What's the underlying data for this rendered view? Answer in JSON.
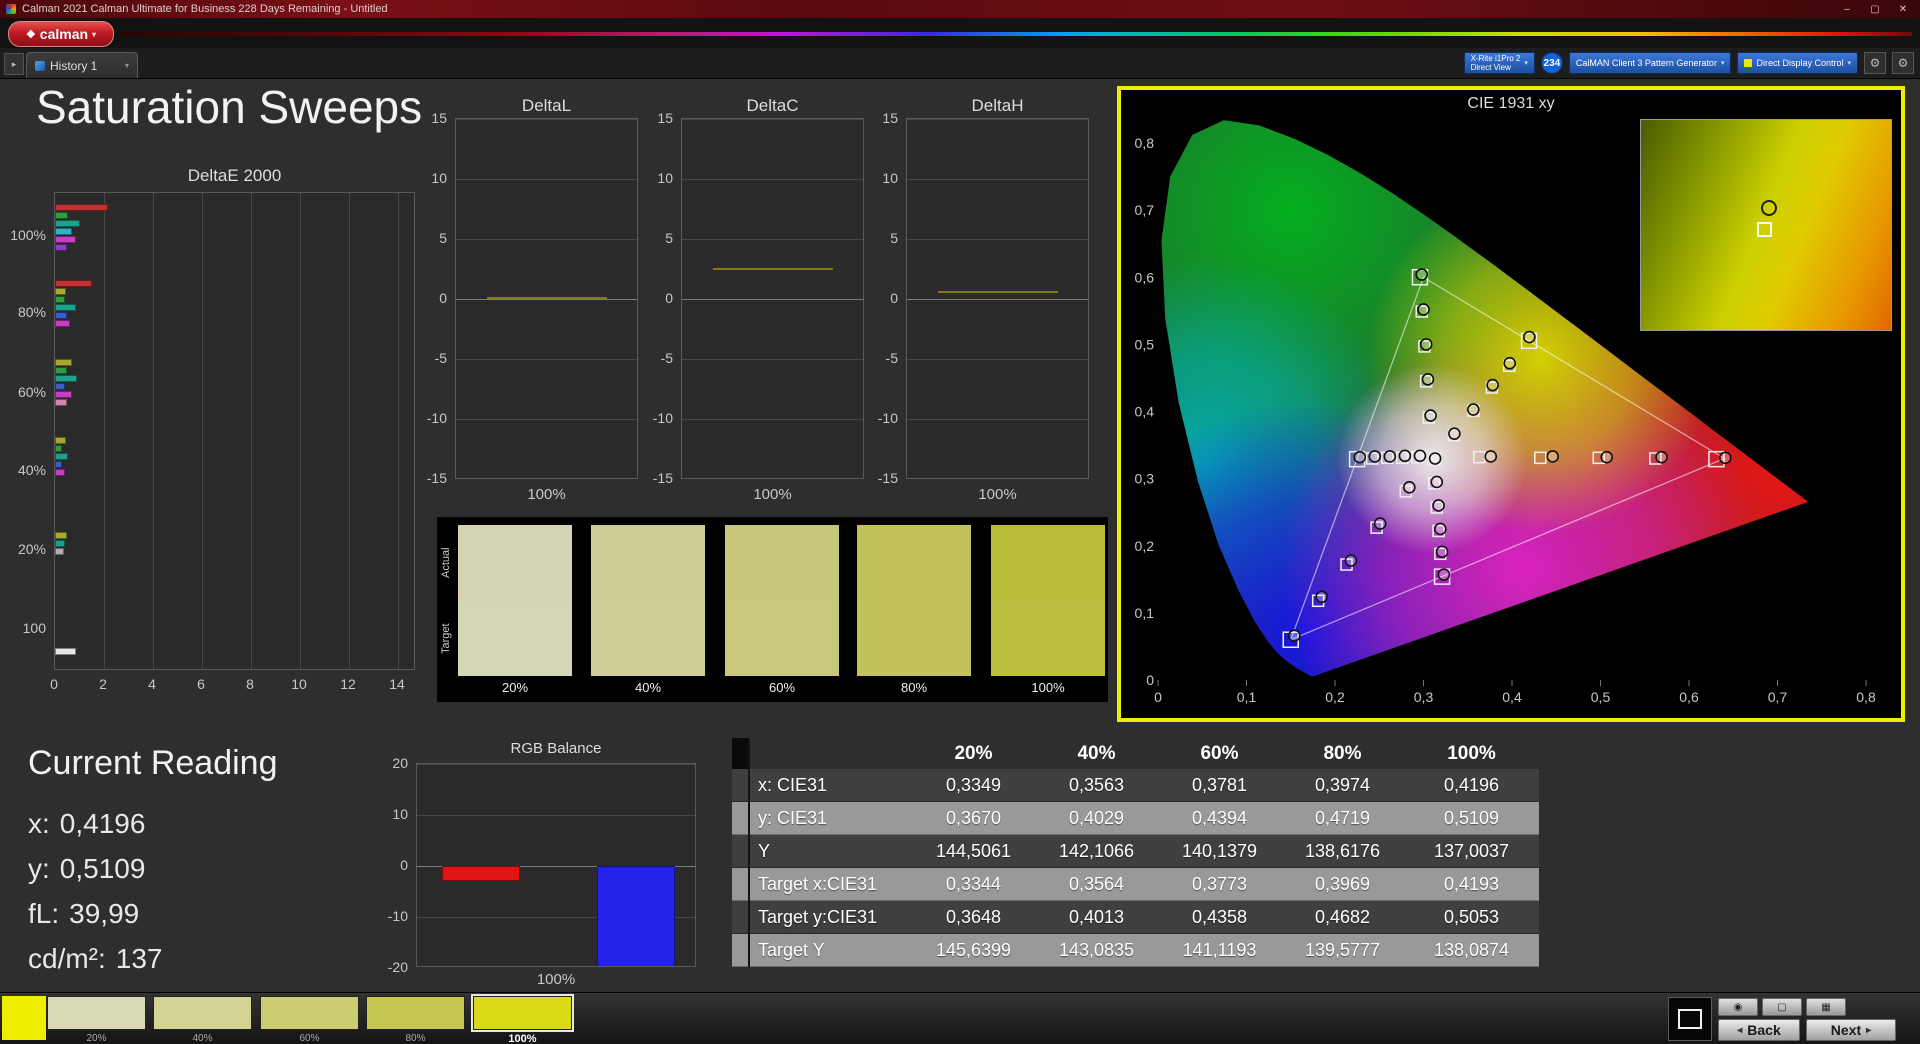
{
  "window": {
    "title": "Calman 2021 Calman Ultimate for Business 228 Days Remaining  - Untitled"
  },
  "icons": {
    "app_diamond": "❖",
    "dropdown_arrow": "▾",
    "minimize": "–",
    "maximize": "▢",
    "close": "✕",
    "expander": "▸",
    "gear": "⚙",
    "back_chevron": "◂",
    "next_chevron": "▸",
    "camera": "◉",
    "display": "▢",
    "printer": "▦"
  },
  "brand": {
    "name": "calman"
  },
  "nav": {
    "history_tab": "History 1"
  },
  "toolbar": {
    "meter_line1": "X-Rite i1Pro 2",
    "meter_line2": "Direct View",
    "meter_badge": "234",
    "generator": "CalMAN Client 3 Pattern Generator",
    "display_control": "Direct Display Control"
  },
  "page_title": "Saturation Sweeps",
  "current_reading": {
    "title": "Current Reading",
    "lines": [
      {
        "label": "x:",
        "value": "0,4196"
      },
      {
        "label": "y:",
        "value": "0,5109"
      },
      {
        "label": "fL:",
        "value": "39,99"
      },
      {
        "label": "cd/m²:",
        "value": "137"
      }
    ]
  },
  "bottom": {
    "back_label": "Back",
    "next_label": "Next",
    "swatches": [
      {
        "label": "20%",
        "color": "#dadab6",
        "selected": false
      },
      {
        "label": "40%",
        "color": "#d3d394",
        "selected": false
      },
      {
        "label": "60%",
        "color": "#cccc72",
        "selected": false
      },
      {
        "label": "80%",
        "color": "#c6c650",
        "selected": false
      },
      {
        "label": "100%",
        "color": "#d9d916",
        "selected": true
      }
    ]
  },
  "chart_data": {
    "deltae": {
      "type": "bar",
      "title": "DeltaE 2000",
      "x_ticks": [
        0,
        2,
        4,
        6,
        8,
        10,
        12,
        14
      ],
      "y_labels": [
        {
          "text": "100%",
          "offset": 44
        },
        {
          "text": "80%",
          "offset": 121
        },
        {
          "text": "60%",
          "offset": 201
        },
        {
          "text": "40%",
          "offset": 279
        },
        {
          "text": "20%",
          "offset": 358
        },
        {
          "text": "100",
          "offset": 437
        }
      ],
      "bars": [
        {
          "offset": 11,
          "color": "#c03232",
          "value": 2.15
        },
        {
          "offset": 19,
          "color": "#2d9e42",
          "value": 0.55
        },
        {
          "offset": 27,
          "color": "#1fa08c",
          "value": 1.0
        },
        {
          "offset": 35,
          "color": "#2fb3c4",
          "value": 0.7
        },
        {
          "offset": 43,
          "color": "#c43fc4",
          "value": 0.85
        },
        {
          "offset": 51,
          "color": "#8a3fc4",
          "value": 0.5
        },
        {
          "offset": 87,
          "color": "#c03232",
          "value": 1.5
        },
        {
          "offset": 95,
          "color": "#a8a832",
          "value": 0.45
        },
        {
          "offset": 103,
          "color": "#2d9e42",
          "value": 0.4
        },
        {
          "offset": 111,
          "color": "#1fa08c",
          "value": 0.85
        },
        {
          "offset": 119,
          "color": "#3c5cc8",
          "value": 0.5
        },
        {
          "offset": 127,
          "color": "#c43fc4",
          "value": 0.6
        },
        {
          "offset": 166,
          "color": "#a8a832",
          "value": 0.7
        },
        {
          "offset": 174,
          "color": "#2d9e42",
          "value": 0.5
        },
        {
          "offset": 182,
          "color": "#1fa08c",
          "value": 0.9
        },
        {
          "offset": 190,
          "color": "#3c5cc8",
          "value": 0.4
        },
        {
          "offset": 198,
          "color": "#c43fc4",
          "value": 0.7
        },
        {
          "offset": 206,
          "color": "#d585a8",
          "value": 0.5
        },
        {
          "offset": 244,
          "color": "#a8a832",
          "value": 0.45
        },
        {
          "offset": 252,
          "color": "#2d9e42",
          "value": 0.3
        },
        {
          "offset": 260,
          "color": "#1fa08c",
          "value": 0.55
        },
        {
          "offset": 268,
          "color": "#3c5cc8",
          "value": 0.3
        },
        {
          "offset": 276,
          "color": "#c43fc4",
          "value": 0.4
        },
        {
          "offset": 339,
          "color": "#a8a832",
          "value": 0.5
        },
        {
          "offset": 347,
          "color": "#1fa08c",
          "value": 0.4
        },
        {
          "offset": 355,
          "color": "#b0b0b0",
          "value": 0.35
        },
        {
          "offset": 455,
          "color": "#e8e8e8",
          "value": 0.85
        }
      ]
    },
    "delta_charts": [
      {
        "type": "bar",
        "title": "DeltaL",
        "y_ticks": [
          15,
          10,
          5,
          0,
          -5,
          -10,
          -15
        ],
        "x_label": "100%",
        "value": 0.15
      },
      {
        "type": "bar",
        "title": "DeltaC",
        "y_ticks": [
          15,
          10,
          5,
          0,
          -5,
          -10,
          -15
        ],
        "x_label": "100%",
        "value": 2.6
      },
      {
        "type": "bar",
        "title": "DeltaH",
        "y_ticks": [
          15,
          10,
          5,
          0,
          -5,
          -10,
          -15
        ],
        "x_label": "100%",
        "value": 0.7
      }
    ],
    "swatch_compare": {
      "row_labels": [
        "Actual",
        "Target"
      ],
      "items": [
        {
          "label": "20%",
          "actual": "#d4d4b5",
          "target": "#d5d5b7"
        },
        {
          "label": "40%",
          "actual": "#cdcd97",
          "target": "#cece99"
        },
        {
          "label": "60%",
          "actual": "#c7c779",
          "target": "#c8c87b"
        },
        {
          "label": "80%",
          "actual": "#c1c15b",
          "target": "#c2c25d"
        },
        {
          "label": "100%",
          "actual": "#bbbb3c",
          "target": "#bcbc3e"
        }
      ]
    },
    "cie": {
      "type": "scatter",
      "title": "CIE 1931 xy",
      "x_tick_labels": [
        "0",
        "0,1",
        "0,2",
        "0,3",
        "0,4",
        "0,5",
        "0,6",
        "0,7",
        "0,8"
      ],
      "y_tick_labels": [
        "0",
        "0,1",
        "0,2",
        "0,3",
        "0,4",
        "0,5",
        "0,6",
        "0,7",
        "0,8"
      ],
      "triangle": [
        [
          0.64,
          0.33
        ],
        [
          0.3,
          0.6
        ],
        [
          0.15,
          0.06
        ]
      ],
      "sweeps": [
        {
          "name": "yellow",
          "targets": [
            [
              0.3344,
              0.3648
            ],
            [
              0.3564,
              0.4013
            ],
            [
              0.3773,
              0.4358
            ],
            [
              0.3969,
              0.4682
            ],
            [
              0.4193,
              0.5053
            ]
          ],
          "measured": [
            [
              0.3349,
              0.367
            ],
            [
              0.3563,
              0.4029
            ],
            [
              0.3781,
              0.4394
            ],
            [
              0.3974,
              0.4719
            ],
            [
              0.4196,
              0.5109
            ]
          ]
        },
        {
          "name": "red",
          "targets": [
            [
              0.363,
              0.332
            ],
            [
              0.432,
              0.331
            ],
            [
              0.498,
              0.331
            ],
            [
              0.562,
              0.33
            ],
            [
              0.631,
              0.329
            ]
          ],
          "measured": [
            [
              0.376,
              0.333
            ],
            [
              0.446,
              0.333
            ],
            [
              0.507,
              0.332
            ],
            [
              0.569,
              0.332
            ],
            [
              0.641,
              0.331
            ]
          ]
        },
        {
          "name": "green",
          "targets": [
            [
              0.306,
              0.391
            ],
            [
              0.303,
              0.445
            ],
            [
              0.301,
              0.497
            ],
            [
              0.298,
              0.549
            ],
            [
              0.296,
              0.6
            ]
          ],
          "measured": [
            [
              0.308,
              0.394
            ],
            [
              0.305,
              0.448
            ],
            [
              0.303,
              0.5
            ],
            [
              0.3,
              0.552
            ],
            [
              0.298,
              0.604
            ]
          ]
        },
        {
          "name": "cyan",
          "targets": [
            [
              0.293,
              0.332
            ],
            [
              0.276,
              0.331
            ],
            [
              0.259,
              0.331
            ],
            [
              0.242,
              0.33
            ],
            [
              0.225,
              0.329
            ]
          ],
          "measured": [
            [
              0.296,
              0.334
            ],
            [
              0.279,
              0.334
            ],
            [
              0.262,
              0.333
            ],
            [
              0.245,
              0.333
            ],
            [
              0.228,
              0.332
            ]
          ]
        },
        {
          "name": "blue",
          "targets": [
            [
              0.28,
              0.281
            ],
            [
              0.247,
              0.227
            ],
            [
              0.213,
              0.172
            ],
            [
              0.181,
              0.118
            ],
            [
              0.15,
              0.06
            ]
          ],
          "measured": [
            [
              0.284,
              0.287
            ],
            [
              0.251,
              0.233
            ],
            [
              0.218,
              0.178
            ],
            [
              0.185,
              0.124
            ],
            [
              0.154,
              0.066
            ]
          ]
        },
        {
          "name": "magenta",
          "targets": [
            [
              0.312,
              0.293
            ],
            [
              0.315,
              0.257
            ],
            [
              0.317,
              0.222
            ],
            [
              0.319,
              0.188
            ],
            [
              0.321,
              0.154
            ]
          ],
          "measured": [
            [
              0.315,
              0.295
            ],
            [
              0.317,
              0.26
            ],
            [
              0.319,
              0.225
            ],
            [
              0.321,
              0.191
            ],
            [
              0.323,
              0.157
            ]
          ]
        },
        {
          "name": "white",
          "targets": [
            [
              0.3127,
              0.329
            ]
          ],
          "measured": [
            [
              0.3131,
              0.33
            ]
          ]
        }
      ]
    },
    "rgb_balance": {
      "type": "bar",
      "title": "RGB Balance",
      "y_ticks": [
        20,
        10,
        0,
        -10,
        -20
      ],
      "x_label": "100%",
      "series": [
        {
          "name": "red",
          "value": -3,
          "color": "#e01414"
        },
        {
          "name": "green",
          "value": 0,
          "color": "#18b418"
        },
        {
          "name": "blue",
          "value": -20,
          "color": "#2222e8"
        }
      ]
    },
    "table": {
      "type": "table",
      "columns": [
        "20%",
        "40%",
        "60%",
        "80%",
        "100%"
      ],
      "rows": [
        {
          "label": "x: CIE31",
          "values": [
            "0,3349",
            "0,3563",
            "0,3781",
            "0,3974",
            "0,4196"
          ]
        },
        {
          "label": "y: CIE31",
          "values": [
            "0,3670",
            "0,4029",
            "0,4394",
            "0,4719",
            "0,5109"
          ]
        },
        {
          "label": "Y",
          "values": [
            "144,5061",
            "142,1066",
            "140,1379",
            "138,6176",
            "137,0037"
          ]
        },
        {
          "label": "Target x:CIE31",
          "values": [
            "0,3344",
            "0,3564",
            "0,3773",
            "0,3969",
            "0,4193"
          ]
        },
        {
          "label": "Target y:CIE31",
          "values": [
            "0,3648",
            "0,4013",
            "0,4358",
            "0,4682",
            "0,5053"
          ]
        },
        {
          "label": "Target Y",
          "values": [
            "145,6399",
            "143,0835",
            "141,1193",
            "139,5777",
            "138,0874"
          ]
        }
      ]
    }
  }
}
